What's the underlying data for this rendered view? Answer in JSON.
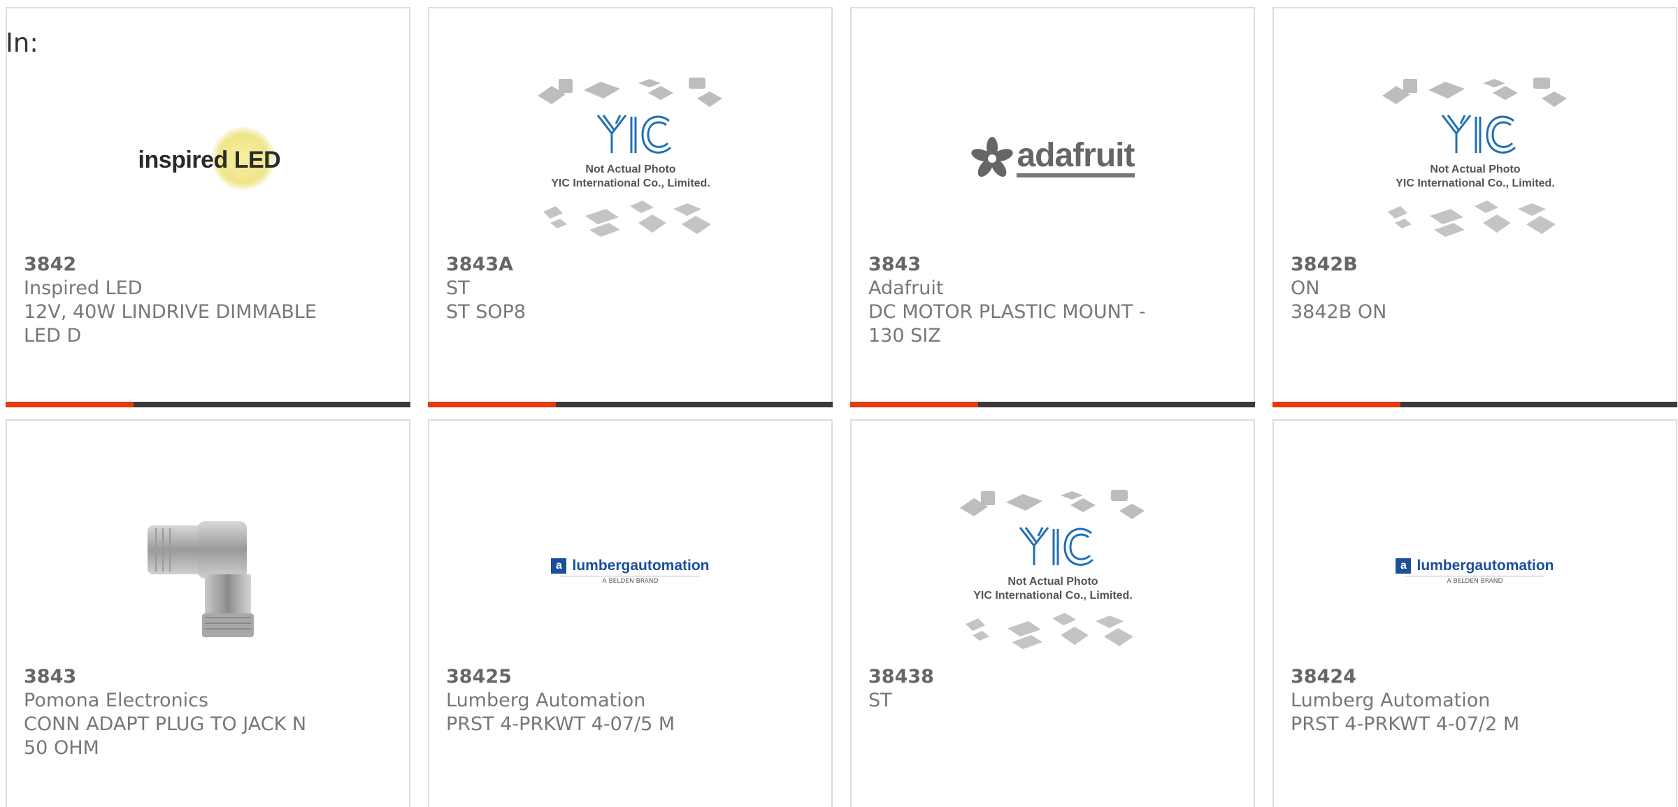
{
  "heading": "In:",
  "colors": {
    "accent": "#e8380d",
    "bar": "#3a3a3a",
    "border": "#dddddd",
    "text": "#777777"
  },
  "cards": [
    {
      "part_number": "3842",
      "manufacturer": "Inspired LED",
      "description": "12V, 40W LINDRIVE DIMMABLE LED D",
      "image": "inspired-led-logo",
      "logo_text": "inspired LED"
    },
    {
      "part_number": "3843A",
      "manufacturer": "ST",
      "description": "ST SOP8",
      "image": "yic-not-actual-photo",
      "logo_text": "YIC",
      "caption_line1": "Not Actual Photo",
      "caption_line2": "YIC International Co., Limited."
    },
    {
      "part_number": "3843",
      "manufacturer": "Adafruit",
      "description": "DC MOTOR PLASTIC MOUNT - 130 SIZ",
      "image": "adafruit-logo",
      "logo_text": "adafruit"
    },
    {
      "part_number": "3842B",
      "manufacturer": "ON",
      "description": "3842B ON",
      "image": "yic-not-actual-photo",
      "logo_text": "YIC",
      "caption_line1": "Not Actual Photo",
      "caption_line2": "YIC International Co., Limited."
    },
    {
      "part_number": "3843",
      "manufacturer": "Pomona Electronics",
      "description": "CONN ADAPT PLUG TO JACK N 50 OHM",
      "image": "n-connector-adapter-photo"
    },
    {
      "part_number": "38425",
      "manufacturer": "Lumberg Automation",
      "description": "PRST 4-PRKWT 4-07/5 M",
      "image": "lumberg-automation-logo",
      "logo_text": "lumbergautomation",
      "logo_sub": "A BELDEN BRAND"
    },
    {
      "part_number": "38438",
      "manufacturer": "ST",
      "description": "",
      "image": "yic-not-actual-photo",
      "logo_text": "YIC",
      "caption_line1": "Not Actual Photo",
      "caption_line2": "YIC International Co., Limited."
    },
    {
      "part_number": "38424",
      "manufacturer": "Lumberg Automation",
      "description": "PRST 4-PRKWT 4-07/2 M",
      "image": "lumberg-automation-logo",
      "logo_text": "lumbergautomation",
      "logo_sub": "A BELDEN BRAND"
    }
  ]
}
